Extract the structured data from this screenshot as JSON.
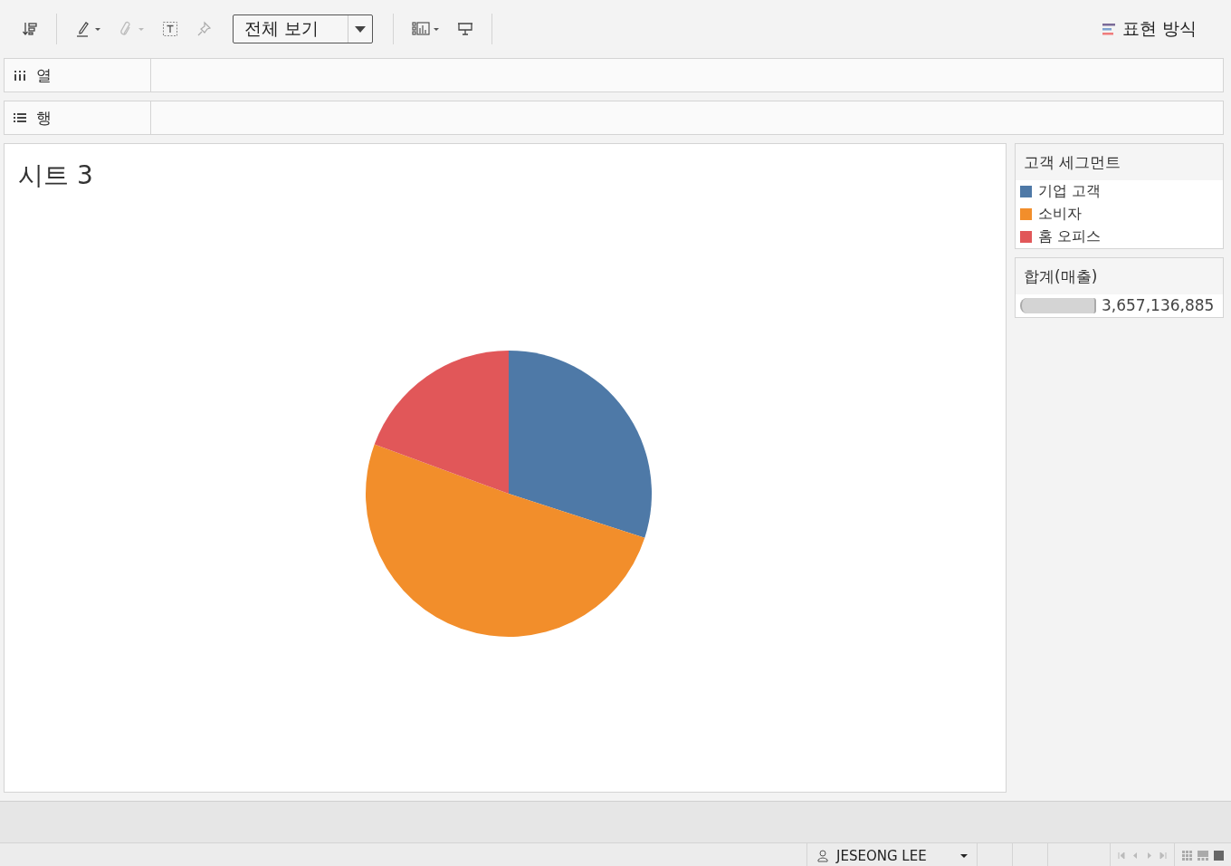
{
  "toolbar": {
    "fit_dropdown": "전체 보기",
    "show_me": "표현 방식"
  },
  "shelves": [
    {
      "kind": "columns",
      "label": "열"
    },
    {
      "kind": "rows",
      "label": "행"
    }
  ],
  "sheet": {
    "title": "시트 3"
  },
  "color_legend": {
    "title": "고객 세그먼트",
    "items": [
      {
        "label": "기업 고객",
        "color": "#4e79a7"
      },
      {
        "label": "소비자",
        "color": "#f28e2b"
      },
      {
        "label": "홈 오피스",
        "color": "#e15759"
      }
    ]
  },
  "size_legend": {
    "title": "합계(매출)",
    "value": "3,657,136,885"
  },
  "status_bar": {
    "user": "JESEONG LEE"
  }
}
